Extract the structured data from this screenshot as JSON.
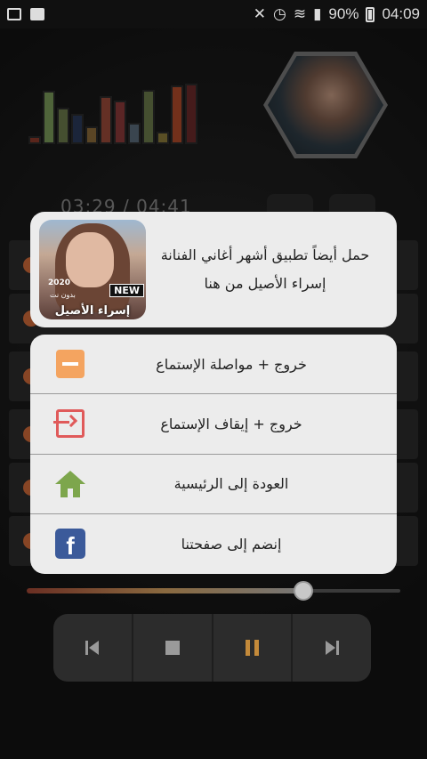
{
  "status_bar": {
    "battery": "90%",
    "time": "04:09"
  },
  "player": {
    "time_display": "03:29 / 04:41",
    "equalizer_levels": [
      0.13,
      0.88,
      0.6,
      0.5,
      0.3,
      0.8,
      0.72,
      0.35,
      0.9,
      0.2,
      0.97,
      1.0
    ],
    "equalizer_colors": [
      "#8a3a2a",
      "#7a9a5a",
      "#6a7a4a",
      "#2a3a5a",
      "#8a6a3a",
      "#9a4a3a",
      "#8a3a3a",
      "#5a6a7a",
      "#6a7a4a",
      "#8a7a3a",
      "#b04a2a",
      "#6a2a2a"
    ],
    "progress": 0.74,
    "controls": [
      "previous",
      "stop",
      "pause",
      "next"
    ]
  },
  "dialog": {
    "promo": {
      "line1": "حمل أيضاً تطبيق أشهر أغاني الفنانة",
      "line2": "إسراء الأصيل من هنا",
      "image_year": "2020",
      "image_subtitle": "بدون نت",
      "image_badge": "NEW",
      "image_name": "إسراء الأصيل"
    },
    "menu": [
      {
        "label": "خروج + مواصلة الإستماع",
        "icon": "minus-icon",
        "color": "#f4a460"
      },
      {
        "label": "خروج + إيقاف الإستماع",
        "icon": "exit-icon",
        "color": "#e05a5a"
      },
      {
        "label": "العودة إلى الرئيسية",
        "icon": "home-icon",
        "color": "#7da64c"
      },
      {
        "label": "إنضم إلى صفحتنا",
        "icon": "facebook-icon",
        "color": "#3b5a9a"
      }
    ]
  }
}
